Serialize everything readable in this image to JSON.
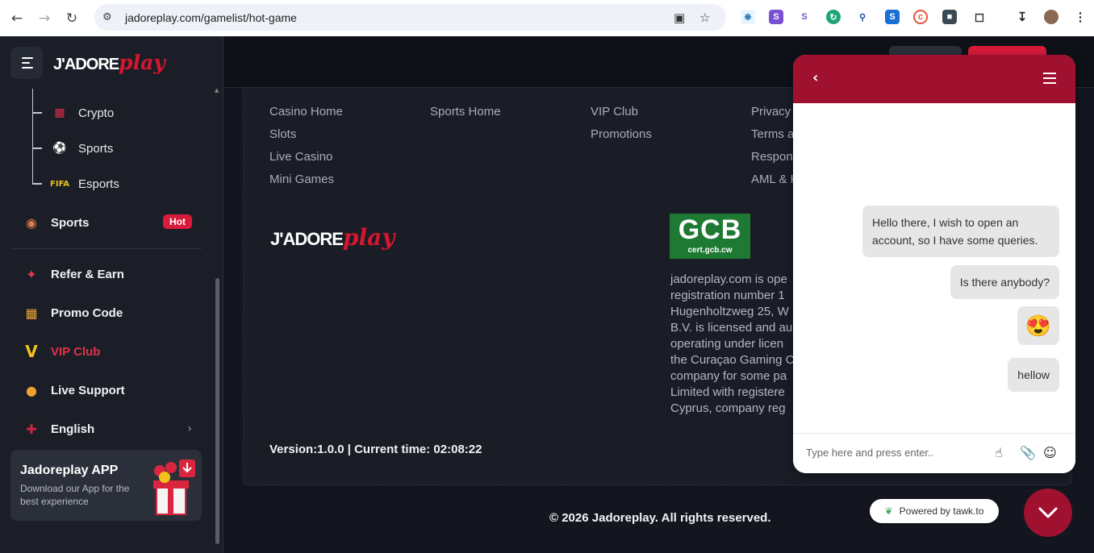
{
  "browser": {
    "url": "jadoreplay.com/gamelist/hot-game"
  },
  "brand": {
    "logo_a": "J'ADORE",
    "logo_b": "play",
    "accent": "#d3172e"
  },
  "sidebar": {
    "sub_items": [
      {
        "label": "Crypto",
        "icon": "crypto-chart-icon"
      },
      {
        "label": "Sports",
        "icon": "soccer-ball-icon"
      },
      {
        "label": "Esports",
        "icon": "fifa-icon"
      }
    ],
    "sports": {
      "label": "Sports",
      "badge": "Hot",
      "icon": "basketball-icon"
    },
    "items": [
      {
        "label": "Refer & Earn",
        "icon": "refer-icon"
      },
      {
        "label": "Promo Code",
        "icon": "gift-box-icon"
      },
      {
        "label": "VIP Club",
        "icon": "vip-crown-icon"
      },
      {
        "label": "Live Support",
        "icon": "support-agent-icon"
      },
      {
        "label": "English",
        "icon": "uk-flag-icon"
      }
    ],
    "app": {
      "title": "Jadoreplay APP",
      "subtitle": "Download our App for the best experience"
    }
  },
  "footer": {
    "col1": [
      "Casino Home",
      "Slots",
      "Live Casino",
      "Mini Games"
    ],
    "col2": [
      "Sports Home"
    ],
    "col3": [
      "VIP Club",
      "Promotions"
    ],
    "col4": [
      "Privacy",
      "Terms a",
      "Respon",
      "AML & K"
    ],
    "gcb_big": "GCB",
    "gcb_small": "cert.gcb.cw",
    "about_lines": [
      "jadoreplay.com is ope",
      "registration number 1",
      "Hugenholtzweg 25, W",
      "B.V. is licensed and au",
      "operating under licen",
      "the Curaçao Gaming C",
      "company for some pa",
      "Limited with registere",
      "Cyprus, company reg"
    ],
    "version": "Version:1.0.0 | Current time: 02:08:22",
    "copyright": "© 2026 Jadoreplay. All rights reserved."
  },
  "chat": {
    "messages": [
      "Hello there, I wish to open an account, so I have some queries.",
      "Is there anybody?",
      "😍",
      "hellow"
    ],
    "input_placeholder": "Type here and press enter..",
    "powered": "Powered by tawk.to",
    "header_color": "#a0102f"
  }
}
